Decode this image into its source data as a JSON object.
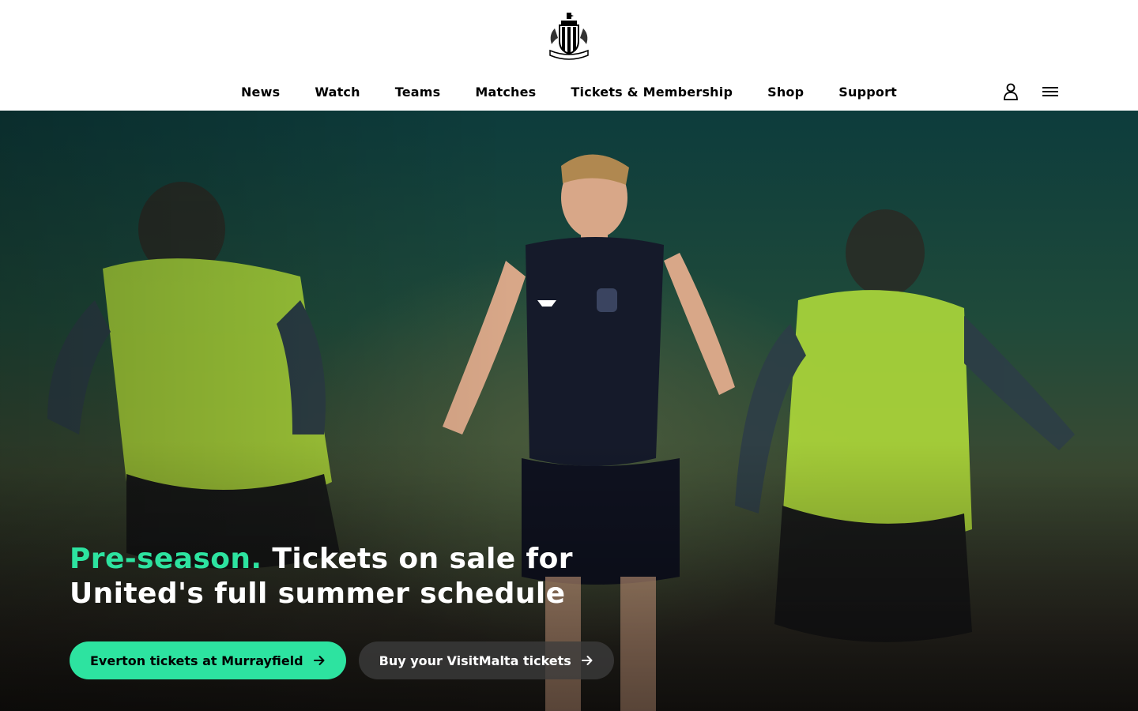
{
  "brand": {
    "crest_icon": "newcastle-united-crest-icon"
  },
  "nav": {
    "items": [
      {
        "label": "News"
      },
      {
        "label": "Watch"
      },
      {
        "label": "Teams"
      },
      {
        "label": "Matches"
      },
      {
        "label": "Tickets & Membership"
      },
      {
        "label": "Shop"
      },
      {
        "label": "Support"
      }
    ],
    "icons": [
      "user-icon",
      "hamburger-menu-icon"
    ]
  },
  "hero": {
    "headline_accent": "Pre-season.",
    "headline_rest": " Tickets on sale for United's full summer schedule",
    "buttons": [
      {
        "label": "Everton tickets at Murrayfield",
        "icon": "arrow-right-icon"
      },
      {
        "label": "Buy your VisitMalta tickets",
        "icon": "arrow-right-icon"
      }
    ]
  },
  "colors": {
    "accent": "#2de3a0",
    "header_bg": "#ffffff",
    "text": "#000000"
  }
}
